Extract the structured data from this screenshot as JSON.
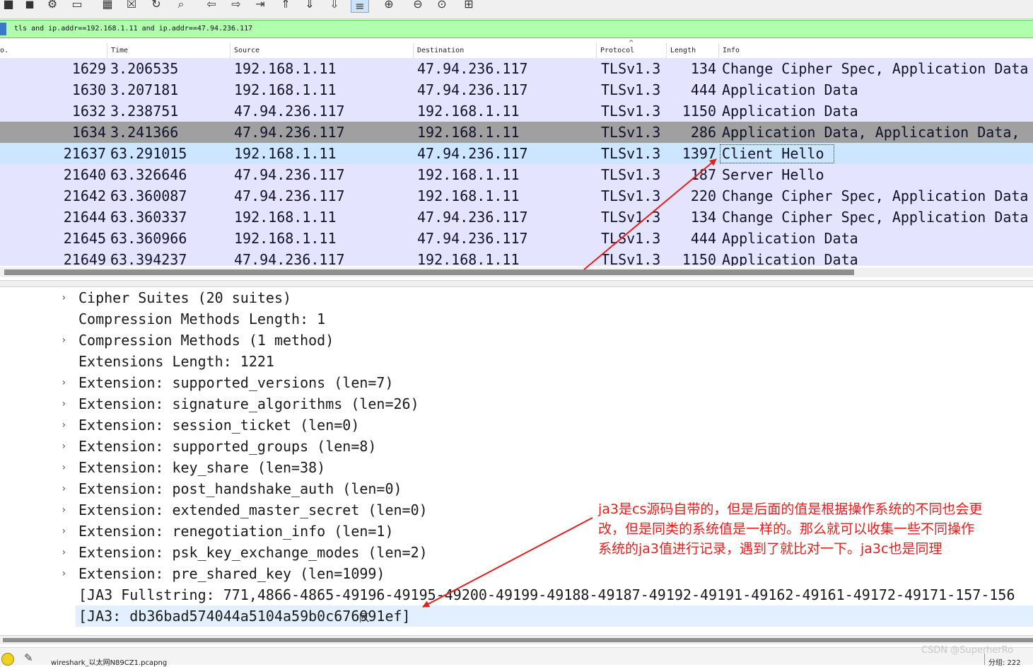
{
  "toolbar": {
    "buttons": [
      {
        "icon": "stop-capture-icon",
        "glyph": "■"
      },
      {
        "icon": "restart-capture-icon",
        "glyph": "◼"
      },
      {
        "icon": "capture-options-icon",
        "glyph": "⚙"
      },
      {
        "icon": "open-file-icon",
        "glyph": "▭"
      },
      {
        "icon": "save-file-icon",
        "glyph": "▦"
      },
      {
        "icon": "close-file-icon",
        "glyph": "☒"
      },
      {
        "icon": "reload-icon",
        "glyph": "↻"
      },
      {
        "icon": "find-packet-icon",
        "glyph": "⌕"
      },
      {
        "icon": "go-back-icon",
        "glyph": "⇦"
      },
      {
        "icon": "go-forward-icon",
        "glyph": "⇨"
      },
      {
        "icon": "go-to-packet-icon",
        "glyph": "⇥"
      },
      {
        "icon": "first-packet-icon",
        "glyph": "⇑"
      },
      {
        "icon": "last-packet-icon",
        "glyph": "⇓"
      },
      {
        "icon": "autoscroll-icon",
        "glyph": "⇩"
      },
      {
        "icon": "colorize-icon",
        "glyph": "≡"
      },
      {
        "icon": "zoom-in-icon",
        "glyph": "⊕"
      },
      {
        "icon": "zoom-out-icon",
        "glyph": "⊖"
      },
      {
        "icon": "zoom-normal-icon",
        "glyph": "⊙"
      },
      {
        "icon": "resize-columns-icon",
        "glyph": "⊞"
      }
    ]
  },
  "filter": {
    "value": "tls and ip.addr==192.168.1.11 and ip.addr==47.94.236.117"
  },
  "packet_list": {
    "columns": [
      "o.",
      "Time",
      "Source",
      "Destination",
      "Protocol",
      "Length",
      "Info"
    ],
    "sort_glyph": "^",
    "rows": [
      {
        "no": "1629",
        "time": "3.206535",
        "src": "192.168.1.11",
        "dst": "47.94.236.117",
        "proto": "TLSv1.3",
        "len": "134",
        "info": "Change Cipher Spec, Application Data",
        "state": "normal"
      },
      {
        "no": "1630",
        "time": "3.207181",
        "src": "192.168.1.11",
        "dst": "47.94.236.117",
        "proto": "TLSv1.3",
        "len": "444",
        "info": "Application Data",
        "state": "normal"
      },
      {
        "no": "1632",
        "time": "3.238751",
        "src": "47.94.236.117",
        "dst": "192.168.1.11",
        "proto": "TLSv1.3",
        "len": "1150",
        "info": "Application Data",
        "state": "normal"
      },
      {
        "no": "1634",
        "time": "3.241366",
        "src": "47.94.236.117",
        "dst": "192.168.1.11",
        "proto": "TLSv1.3",
        "len": "286",
        "info": "Application Data, Application Data,",
        "state": "dark"
      },
      {
        "no": "21637",
        "time": "63.291015",
        "src": "192.168.1.11",
        "dst": "47.94.236.117",
        "proto": "TLSv1.3",
        "len": "1397",
        "info": "Client Hello",
        "state": "selected"
      },
      {
        "no": "21640",
        "time": "63.326646",
        "src": "47.94.236.117",
        "dst": "192.168.1.11",
        "proto": "TLSv1.3",
        "len": "187",
        "info": "Server Hello",
        "state": "normal"
      },
      {
        "no": "21642",
        "time": "63.360087",
        "src": "47.94.236.117",
        "dst": "192.168.1.11",
        "proto": "TLSv1.3",
        "len": "220",
        "info": "Change Cipher Spec, Application Data",
        "state": "normal"
      },
      {
        "no": "21644",
        "time": "63.360337",
        "src": "192.168.1.11",
        "dst": "47.94.236.117",
        "proto": "TLSv1.3",
        "len": "134",
        "info": "Change Cipher Spec, Application Data",
        "state": "normal"
      },
      {
        "no": "21645",
        "time": "63.360966",
        "src": "192.168.1.11",
        "dst": "47.94.236.117",
        "proto": "TLSv1.3",
        "len": "444",
        "info": "Application Data",
        "state": "normal"
      },
      {
        "no": "21649",
        "time": "63.394237",
        "src": "47.94.236.117",
        "dst": "192.168.1.11",
        "proto": "TLSv1.3",
        "len": "1150",
        "info": "Application Data",
        "state": "normal"
      }
    ]
  },
  "details": [
    {
      "text": "Cipher Suites (20 suites)",
      "expandable": true,
      "highlight": false
    },
    {
      "text": "Compression Methods Length: 1",
      "expandable": false,
      "highlight": false
    },
    {
      "text": "Compression Methods (1 method)",
      "expandable": true,
      "highlight": false
    },
    {
      "text": "Extensions Length: 1221",
      "expandable": false,
      "highlight": false
    },
    {
      "text": "Extension: supported_versions (len=7)",
      "expandable": true,
      "highlight": false
    },
    {
      "text": "Extension: signature_algorithms (len=26)",
      "expandable": true,
      "highlight": false
    },
    {
      "text": "Extension: session_ticket (len=0)",
      "expandable": true,
      "highlight": false
    },
    {
      "text": "Extension: supported_groups (len=8)",
      "expandable": true,
      "highlight": false
    },
    {
      "text": "Extension: key_share (len=38)",
      "expandable": true,
      "highlight": false
    },
    {
      "text": "Extension: post_handshake_auth (len=0)",
      "expandable": true,
      "highlight": false
    },
    {
      "text": "Extension: extended_master_secret (len=0)",
      "expandable": true,
      "highlight": false
    },
    {
      "text": "Extension: renegotiation_info (len=1)",
      "expandable": true,
      "highlight": false
    },
    {
      "text": "Extension: psk_key_exchange_modes (len=2)",
      "expandable": true,
      "highlight": false
    },
    {
      "text": "Extension: pre_shared_key (len=1099)",
      "expandable": true,
      "highlight": false
    },
    {
      "text": "[JA3 Fullstring: 771,4866-4865-49196-49195-49200-49199-49188-49187-49192-49191-49162-49161-49172-49171-157-156",
      "expandable": false,
      "highlight": false
    },
    {
      "text": "[JA3: db36bad574044a5104a59b0c676991ef]",
      "expandable": false,
      "highlight": true
    }
  ],
  "annotation": {
    "lines": [
      "ja3是cs源码自带的，但是后面的值是根据操作系统的不同也会更",
      "改，但是同类的系统值是一样的。那么就可以收集一些不同操作",
      "系统的ja3值进行记录，遇到了就比对一下。ja3c也是同理"
    ],
    "color": "#e0201f"
  },
  "status": {
    "file": "wireshark_以太网N89CZ1.pcapng",
    "right": "分组: 222",
    "watermark": "CSDN @SuperherRo"
  },
  "colors": {
    "row_bg": "#e4e4ff",
    "row_selected": "#cde6ff",
    "row_dark": "#a0a0a0",
    "filter_bg": "#afffaf"
  }
}
